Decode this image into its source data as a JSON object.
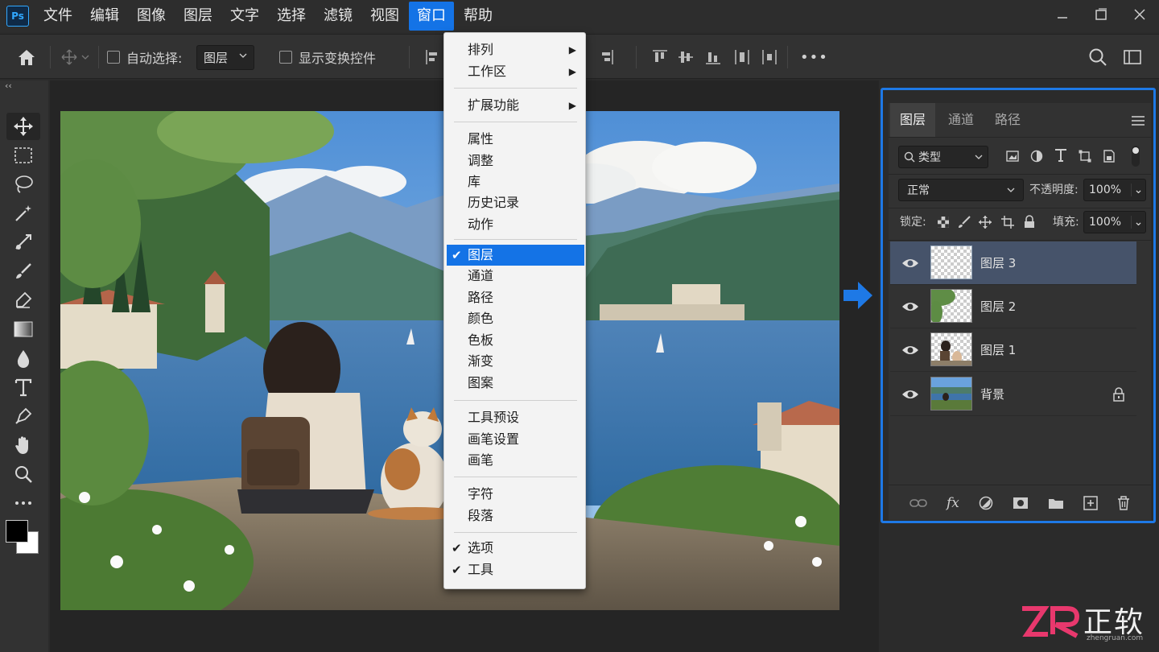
{
  "app": {
    "logo": "Ps"
  },
  "menubar": {
    "items": [
      "文件",
      "编辑",
      "图像",
      "图层",
      "文字",
      "选择",
      "滤镜",
      "视图",
      "窗口",
      "帮助"
    ],
    "active": "窗口"
  },
  "options": {
    "auto_select_label": "自动选择:",
    "auto_select_value": "图层",
    "show_transform_label": "显示变换控件",
    "more": "•••"
  },
  "window_menu": {
    "items": [
      {
        "label": "排列",
        "submenu": true
      },
      {
        "label": "工作区",
        "submenu": true
      },
      {
        "label": "扩展功能",
        "submenu": true
      },
      {
        "label": "属性"
      },
      {
        "label": "调整"
      },
      {
        "label": "库"
      },
      {
        "label": "历史记录"
      },
      {
        "label": "动作"
      },
      {
        "label": "图层",
        "checked": true,
        "selected": true
      },
      {
        "label": "通道"
      },
      {
        "label": "路径"
      },
      {
        "label": "颜色"
      },
      {
        "label": "色板"
      },
      {
        "label": "渐变"
      },
      {
        "label": "图案"
      },
      {
        "label": "工具预设"
      },
      {
        "label": "画笔设置"
      },
      {
        "label": "画笔"
      },
      {
        "label": "字符"
      },
      {
        "label": "段落"
      },
      {
        "label": "选项",
        "checked": true
      },
      {
        "label": "工具",
        "checked": true
      }
    ]
  },
  "layers_panel": {
    "tabs": [
      "图层",
      "通道",
      "路径"
    ],
    "active_tab": "图层",
    "filter_label": "类型",
    "blend_mode": "正常",
    "opacity_label": "不透明度:",
    "opacity_value": "100%",
    "lock_label": "锁定:",
    "fill_label": "填充:",
    "fill_value": "100%",
    "layers": [
      {
        "name": "图层 3",
        "selected": true,
        "locked": false
      },
      {
        "name": "图层 2",
        "selected": false,
        "locked": false
      },
      {
        "name": "图层 1",
        "selected": false,
        "locked": false
      },
      {
        "name": "背景",
        "selected": false,
        "locked": true
      }
    ],
    "footer_fx": "fx"
  },
  "watermark": {
    "brand": "正软",
    "url": "zhengruan.com"
  },
  "colors": {
    "accent": "#1473e6",
    "highlight_border": "#1e79e6",
    "arrow": "#1e79e6",
    "watermark_pink": "#e8386d"
  }
}
